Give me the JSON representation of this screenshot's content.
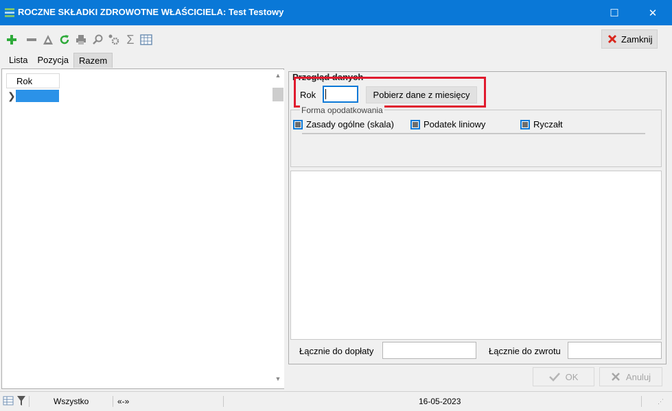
{
  "window": {
    "title": "ROCZNE SKŁADKI ZDROWOTNE WŁAŚCICIELA: Test Testowy",
    "maximize_glyph": "☐",
    "close_glyph": "✕"
  },
  "toolbar": {
    "icons": [
      "add-icon",
      "remove-icon",
      "edit-icon",
      "refresh-icon",
      "print-icon",
      "search-icon",
      "settings-icon",
      "sum-icon",
      "columns-icon"
    ],
    "close_label": "Zamknij"
  },
  "tabs": [
    {
      "label": "Lista",
      "active": false
    },
    {
      "label": "Pozycja",
      "active": false
    },
    {
      "label": "Razem",
      "active": true
    }
  ],
  "list": {
    "column_header": "Rok",
    "selected_row": ""
  },
  "details": {
    "section_title": "Przegląd danych",
    "rok_label": "Rok",
    "rok_value": "",
    "fetch_button": "Pobierz dane z miesięcy",
    "forma_label": "Forma opodatkowania",
    "options": [
      {
        "label": "Zasady ogólne (skala)",
        "checked": "indeterminate"
      },
      {
        "label": "Podatek liniowy",
        "checked": "indeterminate"
      },
      {
        "label": "Ryczałt",
        "checked": "indeterminate"
      }
    ],
    "total_due_label": "Łącznie do dopłaty",
    "total_due_value": "",
    "total_refund_label": "Łącznie do zwrotu",
    "total_refund_value": ""
  },
  "actions": {
    "ok_label": "OK",
    "cancel_label": "Anuluj"
  },
  "status": {
    "filter": "Wszystko",
    "nav": "«-»",
    "date": "16-05-2023"
  },
  "colors": {
    "title_bar": "#0a78d7",
    "highlight": "#e0192d",
    "selection": "#2b92e8",
    "add_icon": "#2eaa3a",
    "close_icon": "#d9261c"
  }
}
